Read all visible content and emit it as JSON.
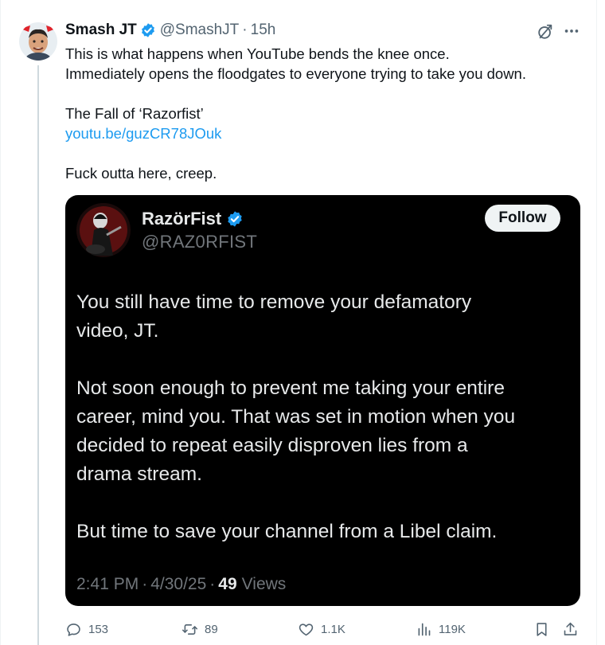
{
  "tweet": {
    "author_name": "Smash JT",
    "author_handle": "@SmashJT",
    "separator": "·",
    "time": "15h",
    "lines": [
      "This is what happens when YouTube bends the knee once.",
      "Immediately opens the floodgates to everyone trying to take you down.",
      "",
      "The Fall of ‘Razorfist’",
      "youtu.be/guzCR78JOuk",
      "",
      "Fuck outta here, creep."
    ]
  },
  "quote": {
    "name": "RazörFist",
    "handle": "@RAZ0RFIST",
    "follow_label": "Follow",
    "lines": [
      "You still have time to remove your defamatory",
      "video, JT.",
      "",
      "Not soon enough to prevent me taking your entire",
      "career, mind you. That was set in motion when you",
      "decided to repeat easily disproven lies from a",
      "drama stream.",
      "",
      "But time to save your channel from a Libel claim."
    ],
    "time": "2:41 PM",
    "date": "4/30/25",
    "views_count": "49",
    "views_label": "Views",
    "separator": "·"
  },
  "actions": {
    "replies": "153",
    "reposts": "89",
    "likes": "1.1K",
    "views": "119K"
  },
  "icons": {
    "verified": "verified-badge-icon",
    "grok": "grok-icon",
    "more": "more-icon",
    "reply": "reply-icon",
    "retweet": "retweet-icon",
    "like": "heart-icon",
    "views": "bar-chart-icon",
    "bookmark": "bookmark-icon",
    "share": "share-icon"
  },
  "colors": {
    "link": "#1d9bf0",
    "verified": "#1d9bf0",
    "secondary_text": "#536471",
    "card_bg": "#000000",
    "card_text": "#e7e9ea"
  }
}
